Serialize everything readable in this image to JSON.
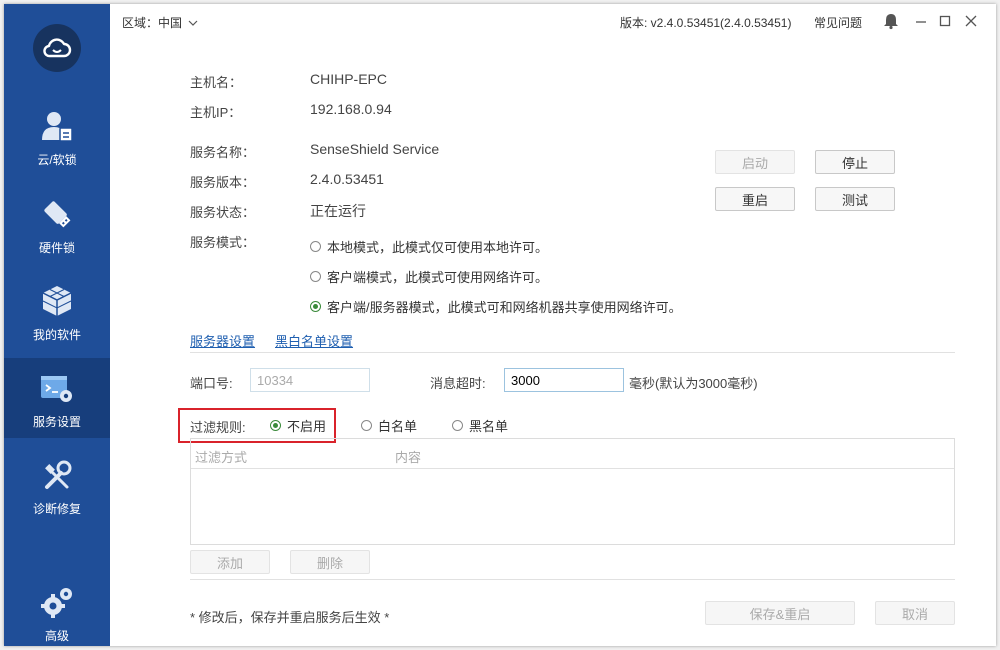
{
  "topbar": {
    "region_label": "区域：中国",
    "version": "版本: v2.4.0.53451(2.4.0.53451)",
    "faq": "常见问题"
  },
  "sidebar": {
    "items": [
      {
        "label": "云/软锁",
        "icon": "user-icon"
      },
      {
        "label": "硬件锁",
        "icon": "usb-key-icon"
      },
      {
        "label": "我的软件",
        "icon": "cube-icon"
      },
      {
        "label": "服务设置",
        "icon": "terminal-settings-icon",
        "active": true
      },
      {
        "label": "诊断修复",
        "icon": "repair-tools-icon"
      },
      {
        "label": "高级",
        "icon": "gears-icon"
      }
    ]
  },
  "info": {
    "hostname_label": "主机名：",
    "hostname": "CHIHP-EPC",
    "hostip_label": "主机IP：",
    "hostip": "192.168.0.94",
    "service_name_label": "服务名称：",
    "service_name": "SenseShield Service",
    "service_version_label": "服务版本：",
    "service_version": "2.4.0.53451",
    "service_status_label": "服务状态：",
    "service_status": "正在运行",
    "service_mode_label": "服务模式："
  },
  "service_buttons": {
    "start": "启动",
    "stop": "停止",
    "restart": "重启",
    "test": "测试"
  },
  "modes": [
    {
      "label": "本地模式，此模式仅可使用本地许可。",
      "checked": false
    },
    {
      "label": "客户端模式，此模式可使用网络许可。",
      "checked": false
    },
    {
      "label": "客户端/服务器模式，此模式可和网络机器共享使用网络许可。",
      "checked": true
    }
  ],
  "tabs": {
    "server": "服务器设置",
    "blacklist": "黑白名单设置"
  },
  "server": {
    "port_label": "端口号:",
    "port_value": "10334",
    "timeout_label": "消息超时:",
    "timeout_value": "3000",
    "timeout_unit": "毫秒(默认为3000毫秒)"
  },
  "filter": {
    "label": "过滤规则:",
    "options": [
      {
        "label": "不启用",
        "checked": true
      },
      {
        "label": "白名单",
        "checked": false
      },
      {
        "label": "黑名单",
        "checked": false
      }
    ],
    "col_method": "过滤方式",
    "col_content": "内容",
    "add": "添加",
    "delete": "删除"
  },
  "footer": {
    "note": "* 修改后，保存并重启服务后生效 *",
    "save": "保存&重启",
    "cancel": "取消"
  },
  "colors": {
    "sidebar": "#1f4e98",
    "sidebar_active": "#173e7c",
    "link": "#1f5fb0",
    "highlight": "#d9232b",
    "radio_checked": "#3a8a3a"
  }
}
